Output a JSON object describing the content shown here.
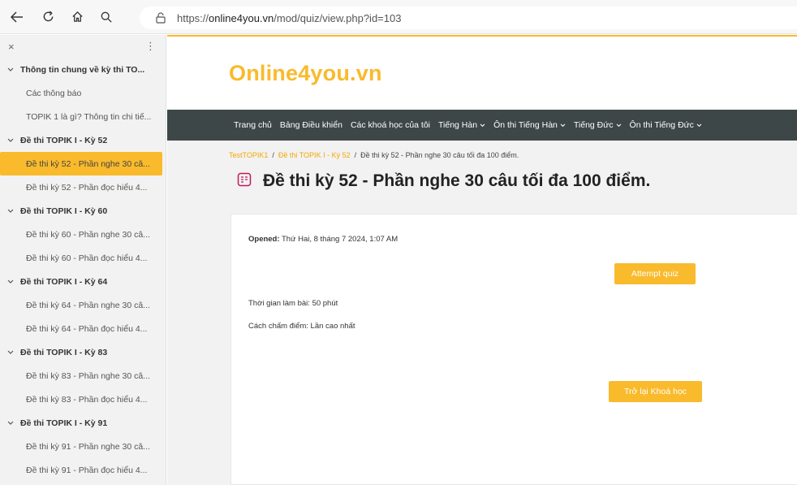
{
  "browser": {
    "url_prefix": "https://",
    "url_host": "online4you.vn",
    "url_path": "/mod/quiz/view.php?id=103"
  },
  "sidebar": {
    "items": [
      {
        "type": "section",
        "label": "Thông tin chung về kỳ thi TO..."
      },
      {
        "type": "child",
        "label": "Các thông báo"
      },
      {
        "type": "child",
        "label": "TOPIK 1 là gì? Thông tin chi tiế..."
      },
      {
        "type": "section",
        "label": "Đề thi TOPIK I - Kỳ 52"
      },
      {
        "type": "child",
        "label": "Đề thi kỳ 52 - Phần nghe 30 câ...",
        "active": true
      },
      {
        "type": "child",
        "label": "Đề thi kỳ 52 - Phần đọc hiểu 4..."
      },
      {
        "type": "section",
        "label": "Đề thi TOPIK I - Kỳ 60"
      },
      {
        "type": "child",
        "label": "Đề thi kỳ 60 - Phần nghe 30 câ..."
      },
      {
        "type": "child",
        "label": "Đề thi kỳ 60 - Phần đọc hiểu 4..."
      },
      {
        "type": "section",
        "label": "Đề thi TOPIK I - Kỳ 64"
      },
      {
        "type": "child",
        "label": "Đề thi kỳ 64 - Phần nghe 30 câ..."
      },
      {
        "type": "child",
        "label": "Đề thi kỳ 64 - Phần đọc hiểu 4..."
      },
      {
        "type": "section",
        "label": "Đề thi TOPIK I - Kỳ 83"
      },
      {
        "type": "child",
        "label": "Đề thi kỳ 83 - Phần nghe 30 câ..."
      },
      {
        "type": "child",
        "label": "Đề thi kỳ 83 - Phần đọc hiểu 4..."
      },
      {
        "type": "section",
        "label": "Đề thi TOPIK I - Kỳ 91"
      },
      {
        "type": "child",
        "label": "Đề thi kỳ 91 - Phần nghe 30 câ..."
      },
      {
        "type": "child",
        "label": "Đề thi kỳ 91 - Phần đọc hiểu 4..."
      }
    ]
  },
  "site": {
    "logo": "Online4you.vn",
    "menu": [
      {
        "label": "Trang chủ",
        "dropdown": false
      },
      {
        "label": "Bảng Điều khiển",
        "dropdown": false
      },
      {
        "label": "Các khoá học của tôi",
        "dropdown": false
      },
      {
        "label": "Tiếng Hàn",
        "dropdown": true
      },
      {
        "label": "Ôn thi Tiếng Hàn",
        "dropdown": true
      },
      {
        "label": "Tiếng Đức",
        "dropdown": true
      },
      {
        "label": "Ôn thi Tiếng Đức",
        "dropdown": true
      }
    ]
  },
  "breadcrumb": {
    "items": [
      "TestTOPIK1",
      "Đề thi TOPIK I - Kỳ 52",
      "Đề thi kỳ 52 - Phần nghe 30 câu tối đa 100 điểm."
    ]
  },
  "page": {
    "title": "Đề thi kỳ 52 - Phần nghe 30 câu tối đa 100 điểm.",
    "opened_label": "Opened:",
    "opened_value": "Thứ Hai, 8 tháng 7 2024, 1:07 AM",
    "time_limit": "Thời gian làm bài: 50 phút",
    "grading_method": "Cách chấm điểm: Lần cao nhất",
    "attempt_button": "Attempt quiz",
    "back_button": "Trở lại Khoá học"
  },
  "colors": {
    "accent": "#f9ba2c",
    "menubar": "#3d4748"
  }
}
